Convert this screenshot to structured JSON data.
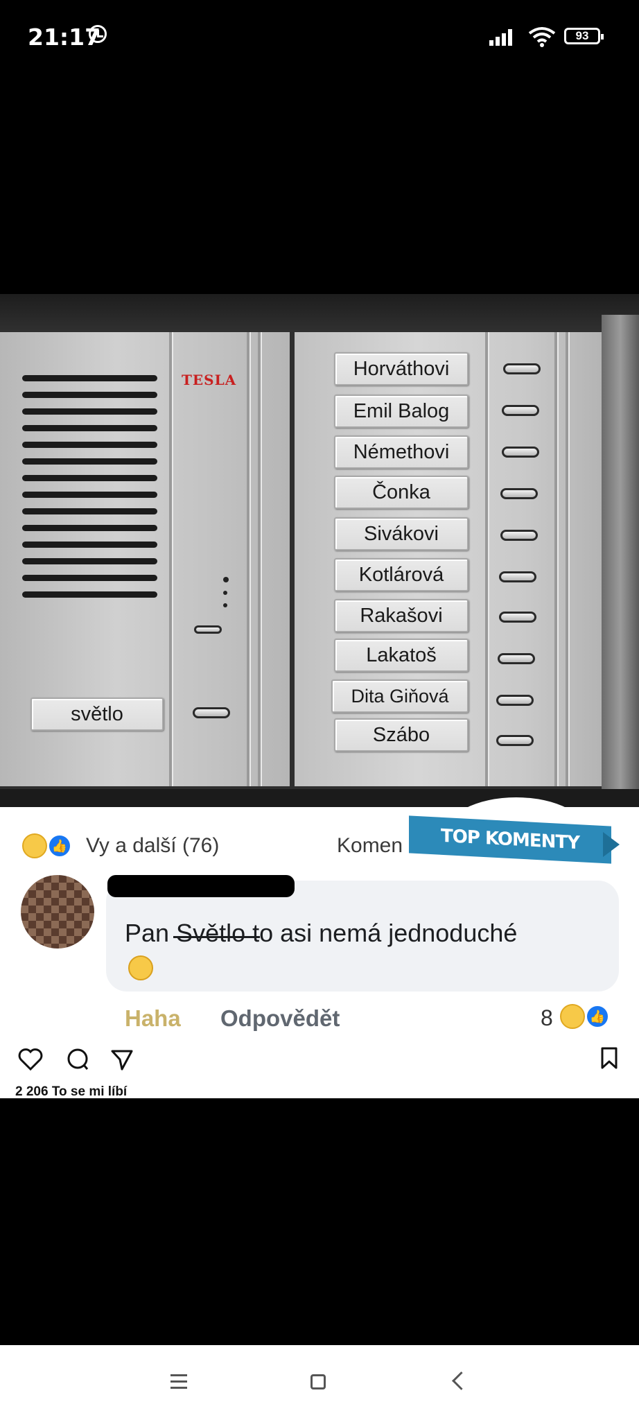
{
  "status_bar": {
    "time": "21:17",
    "battery": "93"
  },
  "photo": {
    "brand": "TESLA",
    "left_button": "světlo",
    "names": [
      "Horváthovi",
      "Emil Balog",
      "Némethovi",
      "Čonka",
      "Sivákovi",
      "Kotlárová",
      "Rakašovi",
      "Lakatoš",
      "Dita Giňová",
      "Szábo"
    ]
  },
  "post": {
    "reactions_text": "Vy a další (76)",
    "comments_text": "Komen",
    "badge": "TOP KOMENTY",
    "comment": "Pan Světlo to asi nemá jednoduché",
    "haha_label": "Haha",
    "reply_label": "Odpovědět",
    "reaction_count": "8",
    "likes": "2 206 To se mi líbí"
  },
  "icons": [
    "alarm-icon",
    "signal-icon",
    "wifi-icon",
    "battery-icon",
    "heart-icon",
    "comment-icon",
    "share-icon",
    "bookmark-icon",
    "menu-icon",
    "home-icon",
    "back-icon"
  ]
}
